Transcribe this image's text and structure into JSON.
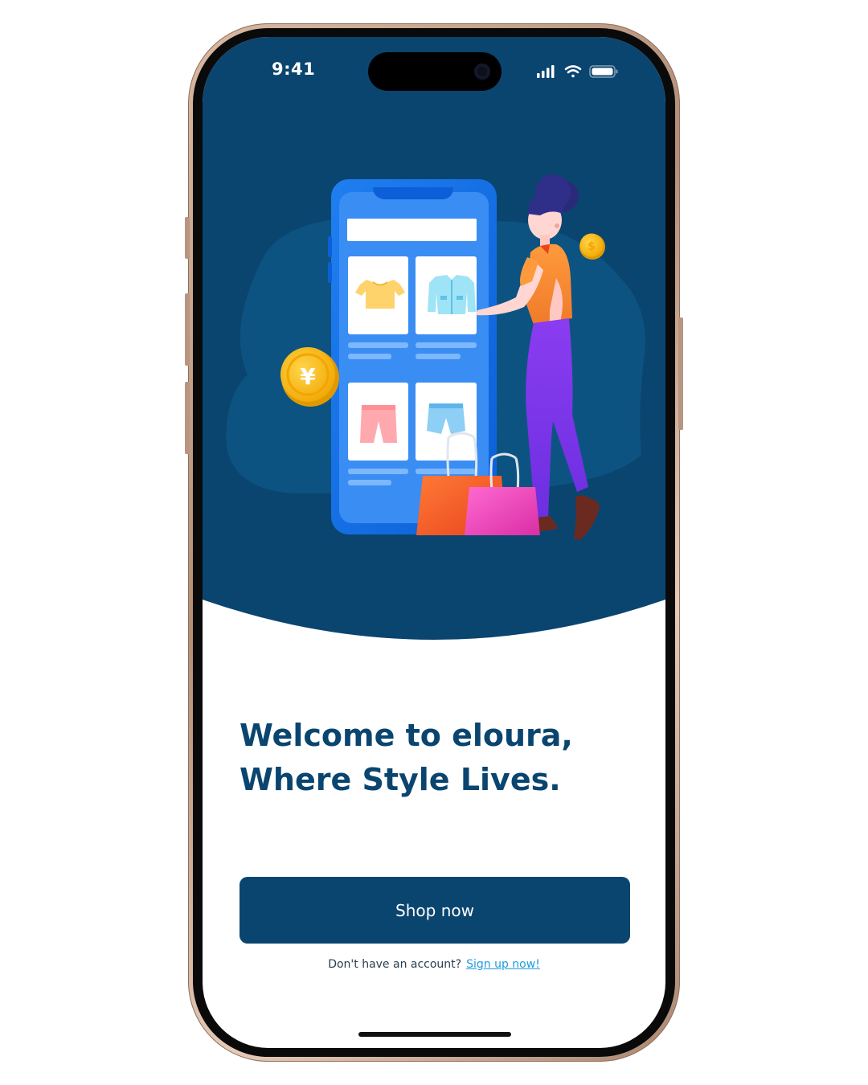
{
  "status_bar": {
    "time": "9:41",
    "icons": [
      "cellular-signal-icon",
      "wifi-icon",
      "battery-icon"
    ]
  },
  "hero": {
    "illustration": "woman-shopping-on-phone-illustration",
    "product_tiles": [
      "tshirt-icon",
      "jacket-icon",
      "shorts-icon",
      "denim-shorts-icon"
    ],
    "coins": [
      "yen-coin-icon",
      "dollar-coin-icon"
    ],
    "coin_labels": {
      "yen": "¥",
      "dollar": "$"
    }
  },
  "welcome": {
    "headline_line1": "Welcome to eloura,",
    "headline_line2": "Where Style Lives."
  },
  "actions": {
    "shop_label": "Shop now",
    "no_account_text": "Don't have an account?",
    "signup_label": "Sign up now!"
  },
  "colors": {
    "primary": "#0a4570",
    "link": "#1e9be0",
    "background": "#ffffff",
    "frame": "#c9a792"
  }
}
